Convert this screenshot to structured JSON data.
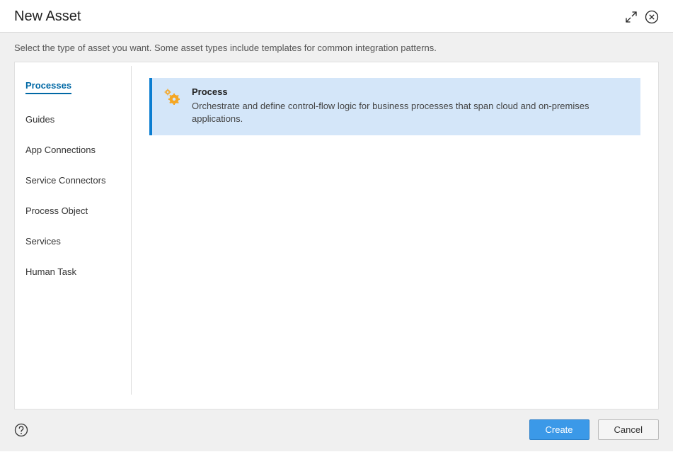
{
  "header": {
    "title": "New Asset"
  },
  "instruction": "Select the type of asset you want. Some asset types include templates for common integration patterns.",
  "sidebar": {
    "items": [
      {
        "label": "Processes",
        "active": true
      },
      {
        "label": "Guides",
        "active": false
      },
      {
        "label": "App Connections",
        "active": false
      },
      {
        "label": "Service Connectors",
        "active": false
      },
      {
        "label": "Process Object",
        "active": false
      },
      {
        "label": "Services",
        "active": false
      },
      {
        "label": "Human Task",
        "active": false
      }
    ]
  },
  "content": {
    "assets": [
      {
        "title": "Process",
        "description": "Orchestrate and define control-flow logic for business processes that span cloud and on-premises applications.",
        "selected": true
      }
    ]
  },
  "footer": {
    "create_label": "Create",
    "cancel_label": "Cancel"
  }
}
